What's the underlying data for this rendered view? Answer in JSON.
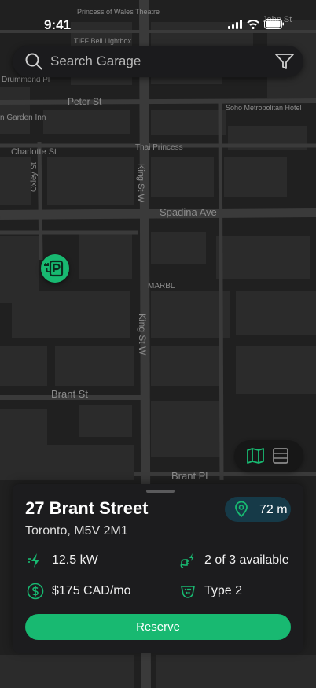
{
  "status_bar": {
    "time": "9:41"
  },
  "search": {
    "placeholder": "Search Garage"
  },
  "map": {
    "labels": [
      {
        "id": "princess-of-wales",
        "text": "Princess of Wales Theatre"
      },
      {
        "id": "john-st",
        "text": "John St"
      },
      {
        "id": "tiff",
        "text": "TIFF Bell Lightbox"
      },
      {
        "id": "drummond",
        "text": "Drummond Pl"
      },
      {
        "id": "peter-st",
        "text": "Peter St"
      },
      {
        "id": "soho",
        "text": "Soho Metropolitan Hotel"
      },
      {
        "id": "garden-inn",
        "text": "n Garden Inn"
      },
      {
        "id": "charlotte",
        "text": "Charlotte St"
      },
      {
        "id": "thai-princess",
        "text": "Thai Princess"
      },
      {
        "id": "oxley",
        "text": "Oxley St"
      },
      {
        "id": "king-st-w-1",
        "text": "King St W"
      },
      {
        "id": "spadina",
        "text": "Spadina Ave"
      },
      {
        "id": "marbl",
        "text": "MARBL"
      },
      {
        "id": "king-st-w-2",
        "text": "King St W"
      },
      {
        "id": "brant-st",
        "text": "Brant St"
      },
      {
        "id": "brant-pl",
        "text": "Brant Pl"
      }
    ]
  },
  "garage": {
    "title": "27 Brant Street",
    "address": "Toronto, M5V 2M1",
    "distance": "72 m",
    "power": "12.5 kW",
    "availability": "2 of 3 available",
    "price": "$175 CAD/mo",
    "connector": "Type 2",
    "reserve_label": "Reserve"
  },
  "colors": {
    "accent": "#18b971",
    "card": "#1c1c1e",
    "map_bg": "#202020",
    "badge": "#163a48"
  }
}
